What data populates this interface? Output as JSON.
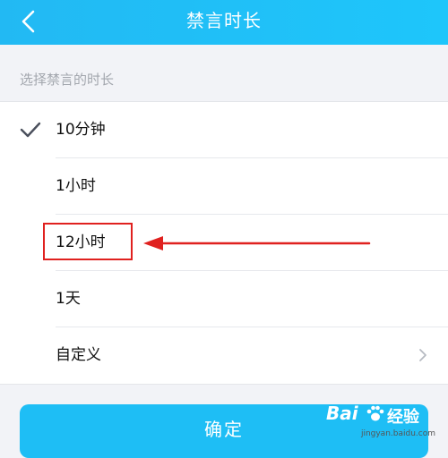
{
  "header": {
    "title": "禁言时长",
    "back_icon": "chevron-left-icon"
  },
  "section_hint": "选择禁言的时长",
  "options": [
    {
      "label": "10分钟",
      "selected": true
    },
    {
      "label": "1小时",
      "selected": false
    },
    {
      "label": "12小时",
      "selected": false
    },
    {
      "label": "1天",
      "selected": false
    },
    {
      "label": "自定义",
      "selected": false,
      "has_chevron": true
    }
  ],
  "confirm_label": "确定",
  "annotation": {
    "color": "#e0211f",
    "target": "12小时"
  },
  "watermark": {
    "logo": "Bai",
    "text": "经验",
    "url": "jingyan.baidu.com"
  },
  "colors": {
    "accent": "#1ebef5",
    "header": "#22b9f3",
    "check": "#4a4f5c"
  }
}
